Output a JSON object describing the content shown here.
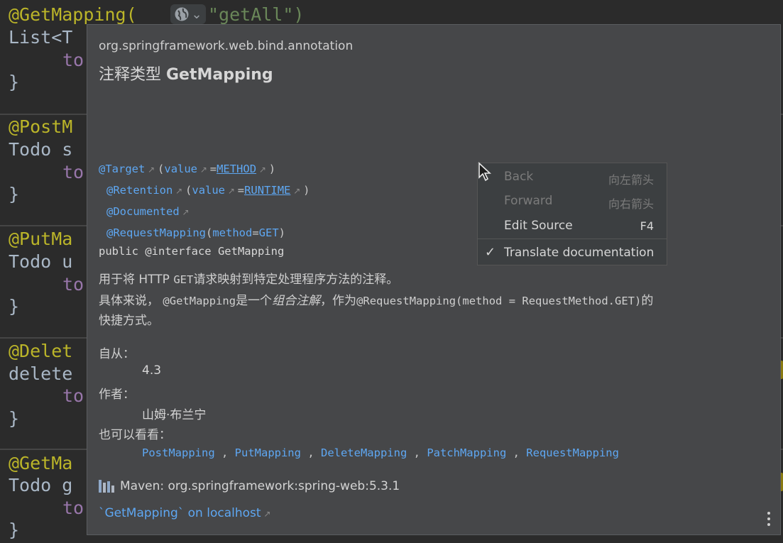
{
  "editor": {
    "lines": [
      {
        "text": "@GetMapping(",
        "type": "ann"
      },
      {
        "text": "\"getAll\")",
        "type": "str"
      },
      {
        "text": "List<T",
        "type": "plain"
      },
      {
        "text": "to",
        "type": "ind"
      },
      {
        "text": "}",
        "type": "plain"
      },
      {
        "text": "@PostM",
        "type": "ann"
      },
      {
        "text": "Todo s",
        "type": "plain"
      },
      {
        "text": "to",
        "type": "ind"
      },
      {
        "text": "}",
        "type": "plain"
      },
      {
        "text": "@PutMa",
        "type": "ann"
      },
      {
        "text": "Todo u",
        "type": "plain"
      },
      {
        "text": "to",
        "type": "ind"
      },
      {
        "text": "}",
        "type": "plain"
      },
      {
        "text": "@Delet",
        "type": "ann"
      },
      {
        "text": "delete",
        "type": "plain"
      },
      {
        "text": "to",
        "type": "ind"
      },
      {
        "text": "}",
        "type": "plain"
      },
      {
        "text": "@GetMa",
        "type": "ann"
      },
      {
        "text": "Todo g",
        "type": "plain"
      },
      {
        "text": "to",
        "type": "ind"
      },
      {
        "text": "}",
        "type": "plain"
      }
    ],
    "globe_icon": "globe-icon",
    "globe_chevron": "⌄",
    "accent_annotation": "#bbb529",
    "accent_string": "#6a8759"
  },
  "doc": {
    "package": "org.springframework.web.bind.annotation",
    "title_prefix": "注释类型 ",
    "title_name": "GetMapping",
    "sig": {
      "target": "@Target",
      "value1": "value",
      "method": "METHOD",
      "retention": "@Retention",
      "value2": "value",
      "runtime": "RUNTIME",
      "documented": "@Documented",
      "request_mapping": "@RequestMapping",
      "method_kw": "method",
      "get": "GET",
      "decl": "public @interface GetMapping"
    },
    "desc1_a": "用于将 HTTP ",
    "desc1_b": "GET",
    "desc1_c": "请求映射到特定处理程序方法的注释。",
    "desc2_a": "具体来说， ",
    "desc2_b": "@GetMapping",
    "desc2_c": "是一个",
    "desc2_d": "组合注解",
    "desc2_e": "，作为",
    "desc2_f": "@RequestMapping(method = RequestMethod.GET)",
    "desc2_g": "的",
    "desc3": "快捷方式。",
    "since_label": "自从：",
    "since_value": "4.3",
    "author_label": "作者：",
    "author_value": "山姆·布兰宁",
    "see_label": "也可以看看：",
    "see_also": [
      "PostMapping",
      "PutMapping",
      "DeleteMapping",
      "PatchMapping",
      "RequestMapping"
    ],
    "maven": "Maven: org.springframework:spring-web:5.3.1",
    "localhost_link": "`GetMapping` on localhost",
    "link_color": "#5ea7f2"
  },
  "menu": {
    "back": {
      "label": "Back",
      "shortcut": "向左箭头"
    },
    "forward": {
      "label": "Forward",
      "shortcut": "向右箭头"
    },
    "edit_source": {
      "label": "Edit Source",
      "shortcut": "F4"
    },
    "translate": {
      "label": "Translate documentation",
      "check": "✓"
    }
  }
}
